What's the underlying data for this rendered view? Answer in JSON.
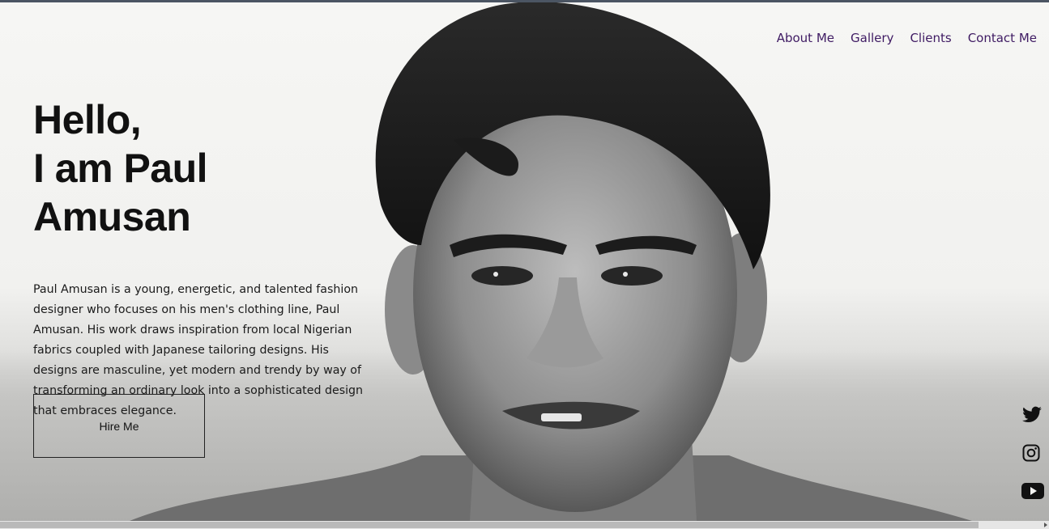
{
  "nav": {
    "items": [
      {
        "label": "About Me"
      },
      {
        "label": "Gallery"
      },
      {
        "label": "Clients"
      },
      {
        "label": "Contact Me"
      }
    ]
  },
  "hero": {
    "greeting": "Hello,",
    "name_line": "I am Paul Amusan",
    "description": "Paul Amusan is a young, energetic, and talented fashion designer who focuses on his men's clothing line, Paul Amusan. His work draws inspiration from local Nigerian fabrics coupled with Japanese tailoring designs. His designs are masculine, yet modern and trendy by way of transforming an ordinary look into a sophisticated design that embraces elegance.",
    "cta_label": "Hire Me"
  },
  "colors": {
    "nav_link": "#3f1b63",
    "heading": "#111111",
    "button_border": "#222222"
  },
  "social": [
    {
      "icon": "twitter-icon"
    },
    {
      "icon": "instagram-icon"
    },
    {
      "icon": "youtube-icon"
    }
  ]
}
